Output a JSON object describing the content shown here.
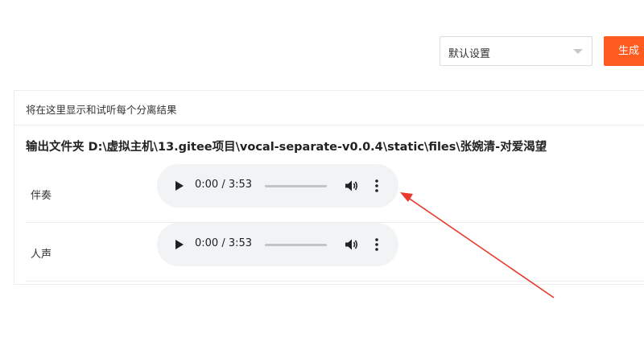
{
  "toolbar": {
    "preset_select_value": "默认设置",
    "generate_label": "生成"
  },
  "panel": {
    "title": "将在这里显示和试听每个分离结果",
    "output_folder": "输出文件夹 D:\\虚拟主机\\13.gitee项目\\vocal-separate-v0.0.4\\static\\files\\张婉清-对爱渴望"
  },
  "tracks": [
    {
      "label": "伴奏",
      "time": "0:00 / 3:53",
      "progress": 0
    },
    {
      "label": "人声",
      "time": "0:00 / 3:53",
      "progress": 0
    }
  ],
  "annotation": {
    "arrow_color": "#e8392c"
  }
}
